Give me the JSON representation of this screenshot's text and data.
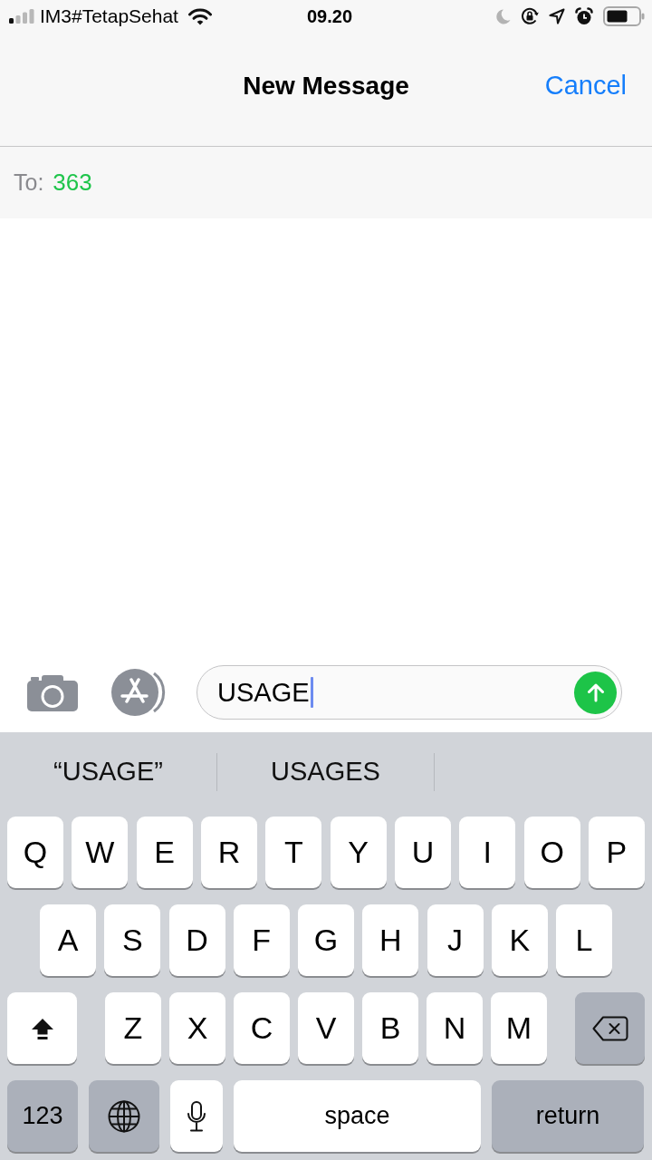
{
  "status_bar": {
    "carrier": "IM3#TetapSehat",
    "time": "09.20"
  },
  "nav_bar": {
    "title": "New Message",
    "cancel_button": "Cancel"
  },
  "recipient": {
    "label": "To:",
    "value": "363"
  },
  "compose": {
    "value": "USAGE"
  },
  "suggestions": [
    {
      "text": "“USAGE”"
    },
    {
      "text": "USAGES"
    }
  ],
  "keyboard": {
    "key_rows": [
      {
        "keys": [
          {
            "kind": "letter",
            "label": "Q"
          },
          {
            "kind": "letter",
            "label": "W"
          },
          {
            "kind": "letter",
            "label": "E"
          },
          {
            "kind": "letter",
            "label": "R"
          },
          {
            "kind": "letter",
            "label": "T"
          },
          {
            "kind": "letter",
            "label": "Y"
          },
          {
            "kind": "letter",
            "label": "U"
          },
          {
            "kind": "letter",
            "label": "I"
          },
          {
            "kind": "letter",
            "label": "O"
          },
          {
            "kind": "letter",
            "label": "P"
          }
        ]
      },
      {
        "keys": [
          {
            "kind": "letter",
            "label": "A"
          },
          {
            "kind": "letter",
            "label": "S"
          },
          {
            "kind": "letter",
            "label": "D"
          },
          {
            "kind": "letter",
            "label": "F"
          },
          {
            "kind": "letter",
            "label": "G"
          },
          {
            "kind": "letter",
            "label": "H"
          },
          {
            "kind": "letter",
            "label": "J"
          },
          {
            "kind": "letter",
            "label": "K"
          },
          {
            "kind": "letter",
            "label": "L"
          }
        ]
      },
      {
        "keys": [
          {
            "kind": "shift",
            "on": true
          },
          {
            "kind": "letter",
            "label": "Z"
          },
          {
            "kind": "letter",
            "label": "X"
          },
          {
            "kind": "letter",
            "label": "C"
          },
          {
            "kind": "letter",
            "label": "V"
          },
          {
            "kind": "letter",
            "label": "B"
          },
          {
            "kind": "letter",
            "label": "N"
          },
          {
            "kind": "letter",
            "label": "M"
          },
          {
            "kind": "delete"
          }
        ]
      },
      {
        "keys": [
          {
            "kind": "numbers",
            "label": "123"
          },
          {
            "kind": "globe"
          },
          {
            "kind": "mic"
          },
          {
            "kind": "space",
            "label": "space"
          },
          {
            "kind": "return",
            "label": "return"
          }
        ]
      }
    ]
  }
}
